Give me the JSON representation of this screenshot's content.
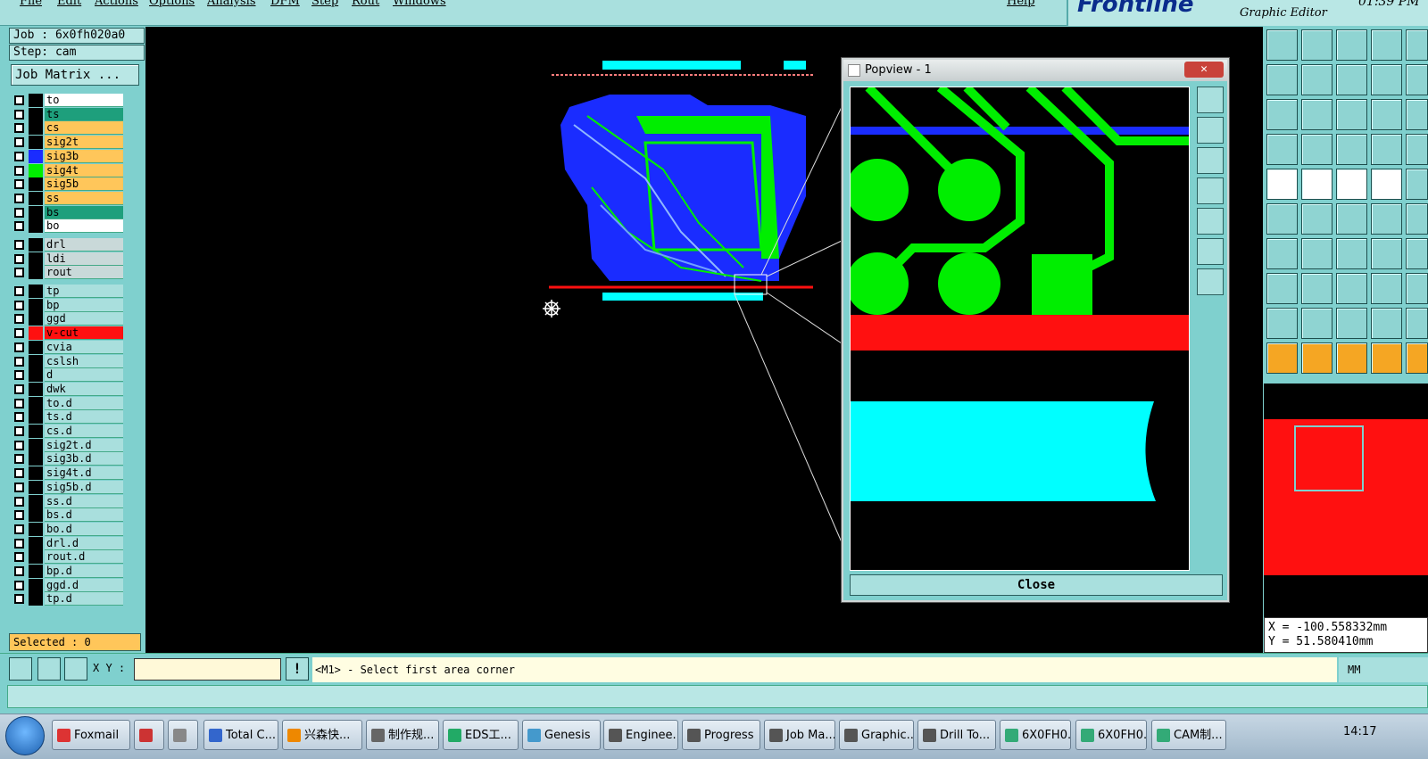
{
  "menu": [
    "File",
    "Edit",
    "Actions",
    "Options",
    "Analysis",
    "DFM",
    "Step",
    "Rout",
    "Windows",
    "Help"
  ],
  "logo": {
    "brand": "Frontline",
    "subtitle": "Graphic Editor",
    "time": "01:39 PM"
  },
  "job": {
    "label": "Job : 6x0fh020a0",
    "step": "Step: cam",
    "matrix_button": "Job Matrix ..."
  },
  "layers_group1": [
    {
      "name": "to",
      "color": "#ffffff"
    },
    {
      "name": "ts",
      "color": "#1e9f7c"
    },
    {
      "name": "cs",
      "color": "#ffc65a"
    },
    {
      "name": "sig2t",
      "color": "#ffc65a"
    },
    {
      "name": "sig3b",
      "color": "#ffc65a"
    },
    {
      "name": "sig4t",
      "color": "#ffc65a"
    },
    {
      "name": "sig5b",
      "color": "#ffc65a"
    },
    {
      "name": "ss",
      "color": "#ffc65a"
    },
    {
      "name": "bs",
      "color": "#1e9f7c"
    },
    {
      "name": "bo",
      "color": "#ffffff"
    }
  ],
  "layers_group2": [
    {
      "name": "drl"
    },
    {
      "name": "ldi"
    },
    {
      "name": "rout"
    }
  ],
  "layers_group3": [
    "tp",
    "bp",
    "ggd",
    "v-cut",
    "cvia",
    "cslsh",
    "d",
    "dwk",
    "to.d",
    "ts.d",
    "cs.d",
    "sig2t.d",
    "sig3b.d",
    "sig4t.d",
    "sig5b.d",
    "ss.d",
    "bs.d",
    "bo.d",
    "drl.d",
    "rout.d",
    "bp.d",
    "ggd.d",
    "tp.d"
  ],
  "selected": "Selected : 0",
  "popview": {
    "title": "Popview - 1",
    "close_x": "✕",
    "close_button": "Close"
  },
  "coords": {
    "x": "X = -100.558332mm",
    "y": "Y = 51.580410mm"
  },
  "command": {
    "xy_label": "X Y :",
    "message": "<M1> - Select first area corner",
    "units": "MM",
    "alert": "!"
  },
  "taskbar": [
    {
      "label": "Foxmail",
      "color": "#d33"
    },
    {
      "label": "",
      "color": "#c33"
    },
    {
      "label": "",
      "color": "#888"
    },
    {
      "label": "Total C...",
      "color": "#36c"
    },
    {
      "label": "兴森快...",
      "color": "#e80"
    },
    {
      "label": "制作规...",
      "color": "#666"
    },
    {
      "label": "EDS工...",
      "color": "#2a6"
    },
    {
      "label": "Genesis",
      "color": "#49c"
    },
    {
      "label": "Enginee...",
      "color": "#555"
    },
    {
      "label": "Progress",
      "color": "#555"
    },
    {
      "label": "Job Ma...",
      "color": "#555"
    },
    {
      "label": "Graphic...",
      "color": "#555"
    },
    {
      "label": "Drill To...",
      "color": "#555"
    },
    {
      "label": "6X0FH0...",
      "color": "#3a7"
    },
    {
      "label": "6X0FH0...",
      "color": "#3a7"
    },
    {
      "label": "CAM制...",
      "color": "#3a7"
    }
  ],
  "clock": "14:17"
}
